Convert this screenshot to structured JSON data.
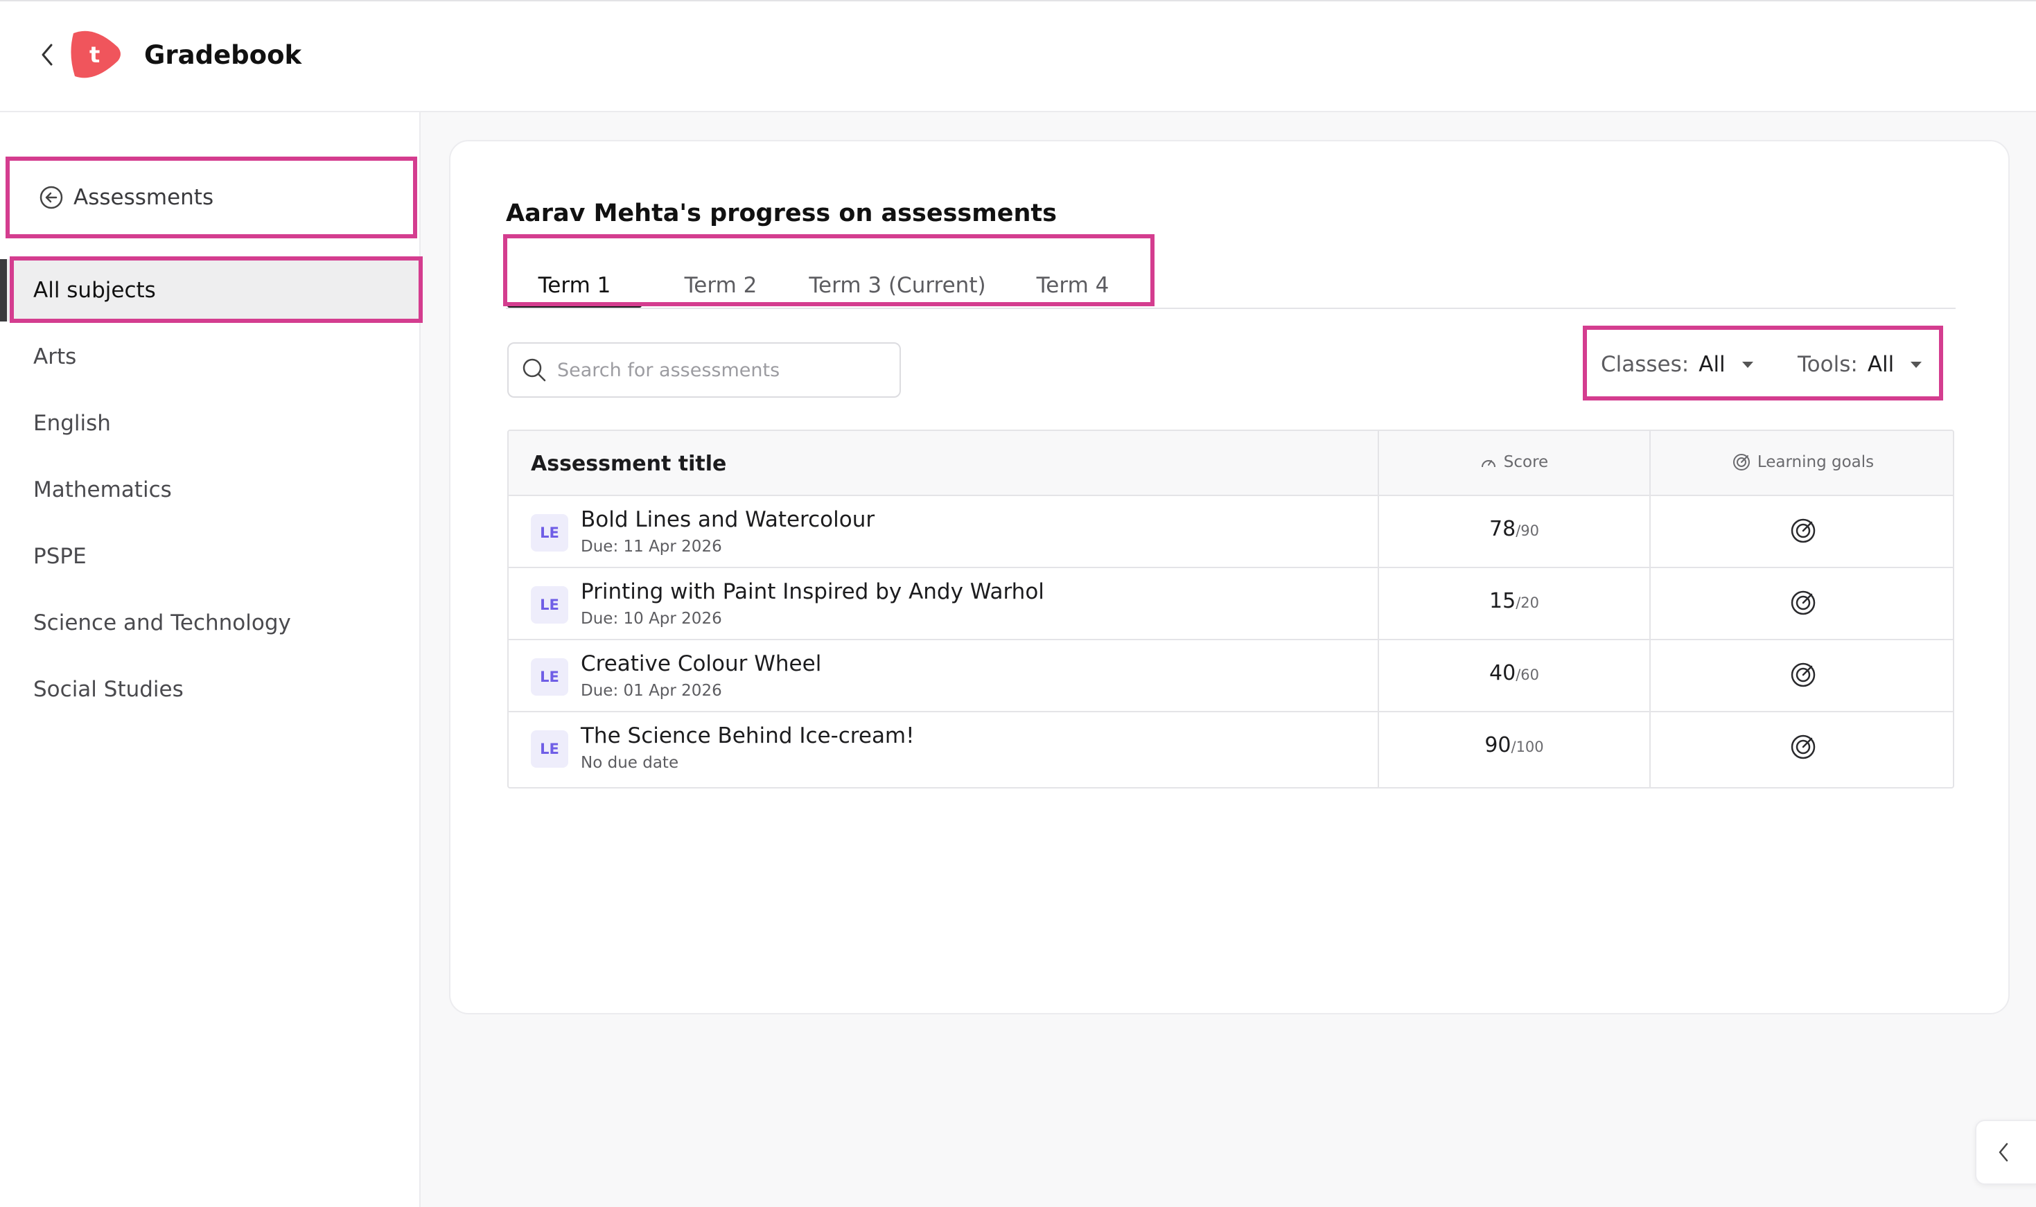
{
  "header": {
    "title": "Gradebook",
    "logo_letter": "t",
    "brand_color": "#f0555c"
  },
  "sidebar": {
    "back_label": "Assessments",
    "items": [
      {
        "label": "All subjects",
        "active": true
      },
      {
        "label": "Arts"
      },
      {
        "label": "English"
      },
      {
        "label": "Mathematics"
      },
      {
        "label": "PSPE"
      },
      {
        "label": "Science and Technology"
      },
      {
        "label": "Social Studies"
      }
    ]
  },
  "main": {
    "title": "Aarav Mehta's progress on assessments",
    "tabs": [
      {
        "label": "Term 1",
        "active": true
      },
      {
        "label": "Term 2"
      },
      {
        "label": "Term 3 (Current)"
      },
      {
        "label": "Term 4"
      }
    ],
    "search": {
      "placeholder": "Search for assessments",
      "value": ""
    },
    "filters": {
      "classes_label": "Classes:",
      "classes_value": "All",
      "tools_label": "Tools:",
      "tools_value": "All"
    },
    "table": {
      "headers": {
        "title": "Assessment title",
        "score": "Score",
        "goals": "Learning goals"
      },
      "rows": [
        {
          "badge": "LE",
          "title": "Bold Lines and Watercolour",
          "due": "Due: 11 Apr 2026",
          "score": "78",
          "max": "/90"
        },
        {
          "badge": "LE",
          "title": "Printing with Paint Inspired by Andy Warhol",
          "due": "Due: 10 Apr 2026",
          "score": "15",
          "max": "/20"
        },
        {
          "badge": "LE",
          "title": "Creative Colour Wheel",
          "due": "Due: 01 Apr 2026",
          "score": "40",
          "max": "/60"
        },
        {
          "badge": "LE",
          "title": "The Science Behind Ice-cream!",
          "due": "No due date",
          "score": "90",
          "max": "/100"
        }
      ]
    }
  },
  "colors": {
    "highlight": "#d43d8f",
    "badge_text": "#6f5ee6",
    "badge_bg": "#eeedfb"
  }
}
